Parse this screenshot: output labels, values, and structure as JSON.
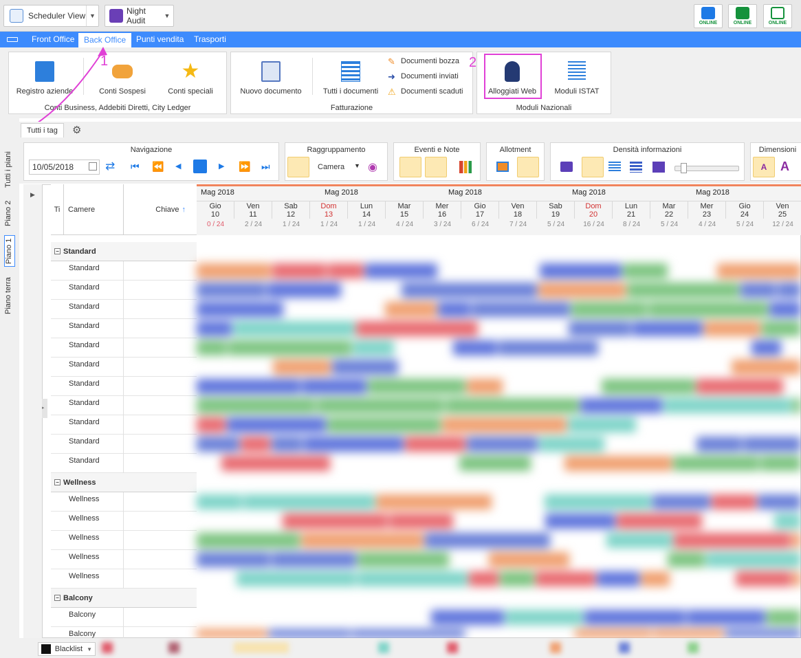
{
  "topbar": {
    "view_button": {
      "label": "Scheduler View",
      "icon": "scheduler-icon"
    },
    "audit_button": {
      "label": "Night Audit",
      "icon": "night-audit-icon"
    },
    "status": [
      {
        "name": "phone",
        "label": "ONLINE",
        "color": "#1e7ae6"
      },
      {
        "name": "chat",
        "label": "ONLINE",
        "color": "#15923c"
      },
      {
        "name": "mail",
        "label": "ONLINE",
        "color": "#15923c"
      }
    ]
  },
  "menu": {
    "items": [
      "Front Office",
      "Back Office",
      "Punti vendita",
      "Trasporti"
    ],
    "active": "Back Office"
  },
  "ribbon": {
    "group1": {
      "label": "Conti Business, Addebiti Diretti, City Ledger",
      "buttons": [
        "Registro aziende",
        "Conti Sospesi",
        "Conti speciali"
      ]
    },
    "group2": {
      "label": "Fatturazione",
      "buttons": [
        "Nuovo documento",
        "Tutti i documenti"
      ],
      "small": [
        "Documenti bozza",
        "Documenti inviati",
        "Documenti scaduti"
      ]
    },
    "group3": {
      "label": "Moduli Nazionali",
      "buttons": [
        "Alloggiati Web",
        "Moduli ISTAT"
      ]
    }
  },
  "annotations": {
    "one": "1",
    "two": "2"
  },
  "tags": {
    "tab": "Tutti i tag"
  },
  "floors": [
    "Tutti i piani",
    "Piano 2",
    "Piano 1",
    "Piano terra"
  ],
  "toolbar": {
    "navigation": {
      "title": "Navigazione",
      "date": "10/05/2018"
    },
    "grouping": {
      "title": "Raggruppamento",
      "value": "Camera"
    },
    "events": {
      "title": "Eventi e Note"
    },
    "allotment": {
      "title": "Allotment"
    },
    "density": {
      "title": "Densità informazioni"
    },
    "dimensions": {
      "title": "Dimensioni"
    }
  },
  "grid": {
    "headers": {
      "type": "Ti",
      "rooms": "Camere",
      "key": "Chiave"
    },
    "months": [
      "Mag 2018",
      "Mag 2018",
      "Mag 2018",
      "Mag 2018",
      "Mag 2018"
    ],
    "days": [
      {
        "dow": "Gio",
        "num": "10",
        "occ": "0 / 24"
      },
      {
        "dow": "Ven",
        "num": "11",
        "occ": "2 / 24"
      },
      {
        "dow": "Sab",
        "num": "12",
        "occ": "1 / 24"
      },
      {
        "dow": "Dom",
        "num": "13",
        "occ": "1 / 24"
      },
      {
        "dow": "Lun",
        "num": "14",
        "occ": "1 / 24"
      },
      {
        "dow": "Mar",
        "num": "15",
        "occ": "4 / 24"
      },
      {
        "dow": "Mer",
        "num": "16",
        "occ": "3 / 24"
      },
      {
        "dow": "Gio",
        "num": "17",
        "occ": "6 / 24"
      },
      {
        "dow": "Ven",
        "num": "18",
        "occ": "7 / 24"
      },
      {
        "dow": "Sab",
        "num": "19",
        "occ": "5 / 24"
      },
      {
        "dow": "Dom",
        "num": "20",
        "occ": "16 / 24"
      },
      {
        "dow": "Lun",
        "num": "21",
        "occ": "8 / 24"
      },
      {
        "dow": "Mar",
        "num": "22",
        "occ": "5 / 24"
      },
      {
        "dow": "Mer",
        "num": "23",
        "occ": "4 / 24"
      },
      {
        "dow": "Gio",
        "num": "24",
        "occ": "5 / 24"
      },
      {
        "dow": "Ven",
        "num": "25",
        "occ": "12 / 24"
      }
    ],
    "groups": [
      {
        "name": "Standard",
        "rooms": [
          "Standard",
          "Standard",
          "Standard",
          "Standard",
          "Standard",
          "Standard",
          "Standard",
          "Standard",
          "Standard",
          "Standard",
          "Standard"
        ]
      },
      {
        "name": "Wellness",
        "rooms": [
          "Wellness",
          "Wellness",
          "Wellness",
          "Wellness",
          "Wellness"
        ]
      },
      {
        "name": "Balcony",
        "rooms": [
          "Balcony",
          "Balcony"
        ]
      }
    ]
  },
  "footer": {
    "legend": "Blacklist"
  }
}
